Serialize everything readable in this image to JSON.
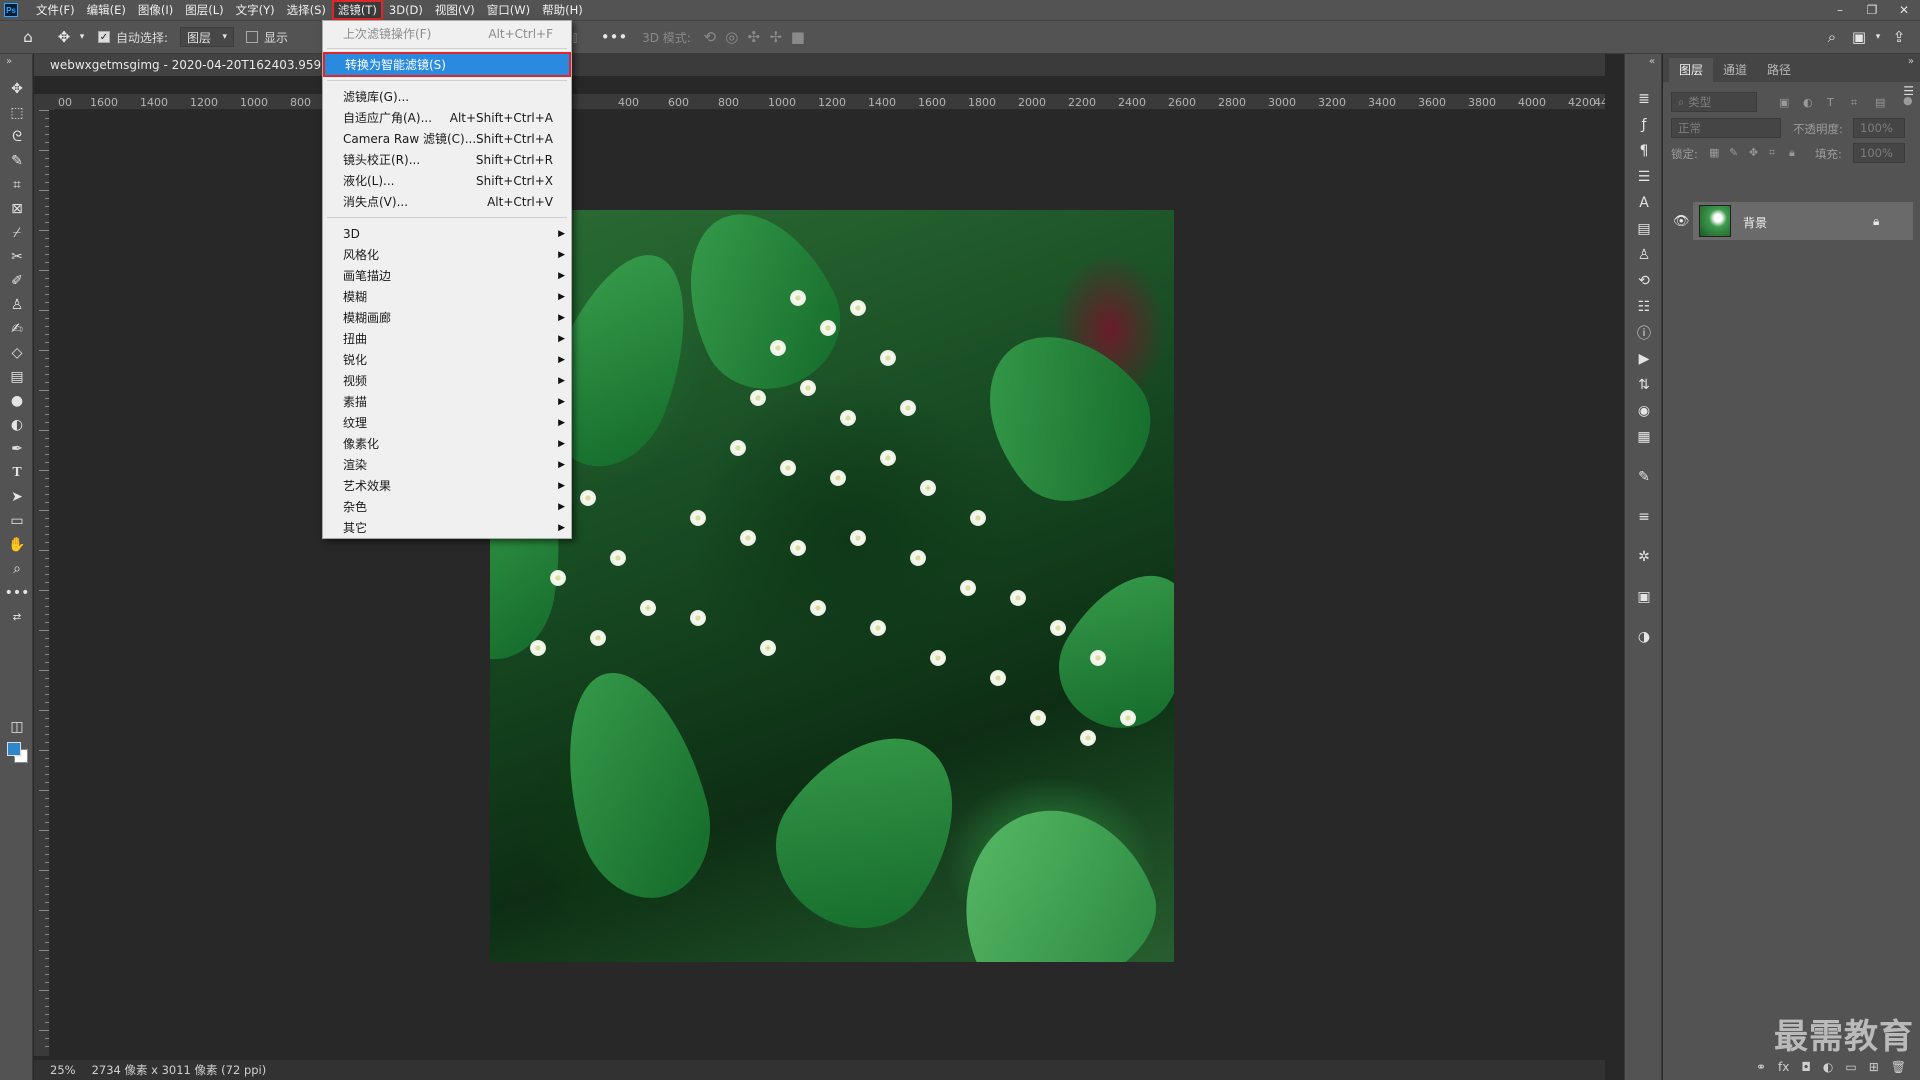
{
  "app": {
    "logo": "Ps"
  },
  "menubar": {
    "items": [
      "文件(F)",
      "编辑(E)",
      "图像(I)",
      "图层(L)",
      "文字(Y)",
      "选择(S)",
      "滤镜(T)",
      "3D(D)",
      "视图(V)",
      "窗口(W)",
      "帮助(H)"
    ],
    "active": "滤镜(T)"
  },
  "window_controls": {
    "minimize": "–",
    "restore": "❐",
    "close": "✕"
  },
  "options_bar": {
    "auto_select_label": "自动选择:",
    "auto_select_checked": true,
    "auto_select_target": "图层",
    "show_transform_label": "显示",
    "mode_3d_label": "3D 模式:"
  },
  "document": {
    "tab_title": "webwxgetmsgimg - 2020-04-20T162403.959.jpg",
    "ruler_top_labels": [
      "00",
      "1600",
      "1400",
      "1200",
      "1000",
      "800",
      "400",
      "600",
      "800",
      "1000",
      "1200",
      "1400",
      "1600",
      "1800",
      "2000",
      "2200",
      "2400",
      "2600",
      "2800",
      "3000",
      "3200",
      "3400",
      "3600",
      "3800",
      "4000",
      "4200",
      "44"
    ],
    "zoom": "25%",
    "info": "2734 像素 x 3011 像素 (72 ppi)"
  },
  "filter_menu": {
    "items": [
      {
        "label": "上次滤镜操作(F)",
        "shortcut": "Alt+Ctrl+F",
        "disabled": true
      },
      {
        "label": "转换为智能滤镜(S)",
        "highlighted": true
      },
      {
        "label": "滤镜库(G)..."
      },
      {
        "label": "自适应广角(A)...",
        "shortcut": "Alt+Shift+Ctrl+A"
      },
      {
        "label": "Camera Raw 滤镜(C)...",
        "shortcut": "Shift+Ctrl+A"
      },
      {
        "label": "镜头校正(R)...",
        "shortcut": "Shift+Ctrl+R"
      },
      {
        "label": "液化(L)...",
        "shortcut": "Shift+Ctrl+X"
      },
      {
        "label": "消失点(V)...",
        "shortcut": "Alt+Ctrl+V"
      },
      {
        "label": "3D",
        "submenu": true
      },
      {
        "label": "风格化",
        "submenu": true
      },
      {
        "label": "画笔描边",
        "submenu": true
      },
      {
        "label": "模糊",
        "submenu": true
      },
      {
        "label": "模糊画廊",
        "submenu": true
      },
      {
        "label": "扭曲",
        "submenu": true
      },
      {
        "label": "锐化",
        "submenu": true
      },
      {
        "label": "视频",
        "submenu": true
      },
      {
        "label": "素描",
        "submenu": true
      },
      {
        "label": "纹理",
        "submenu": true
      },
      {
        "label": "像素化",
        "submenu": true
      },
      {
        "label": "渲染",
        "submenu": true
      },
      {
        "label": "艺术效果",
        "submenu": true
      },
      {
        "label": "杂色",
        "submenu": true
      },
      {
        "label": "其它",
        "submenu": true
      }
    ]
  },
  "layers_panel": {
    "tabs": [
      "图层",
      "通道",
      "路径"
    ],
    "active_tab": "图层",
    "filter_placeholder": "类型",
    "blend_mode": "正常",
    "opacity_label": "不透明度:",
    "opacity_value": "100%",
    "lock_label": "锁定:",
    "fill_label": "填充:",
    "fill_value": "100%",
    "layers": [
      {
        "name": "背景",
        "visible": true,
        "locked": true
      }
    ]
  },
  "watermark": "最需教育"
}
